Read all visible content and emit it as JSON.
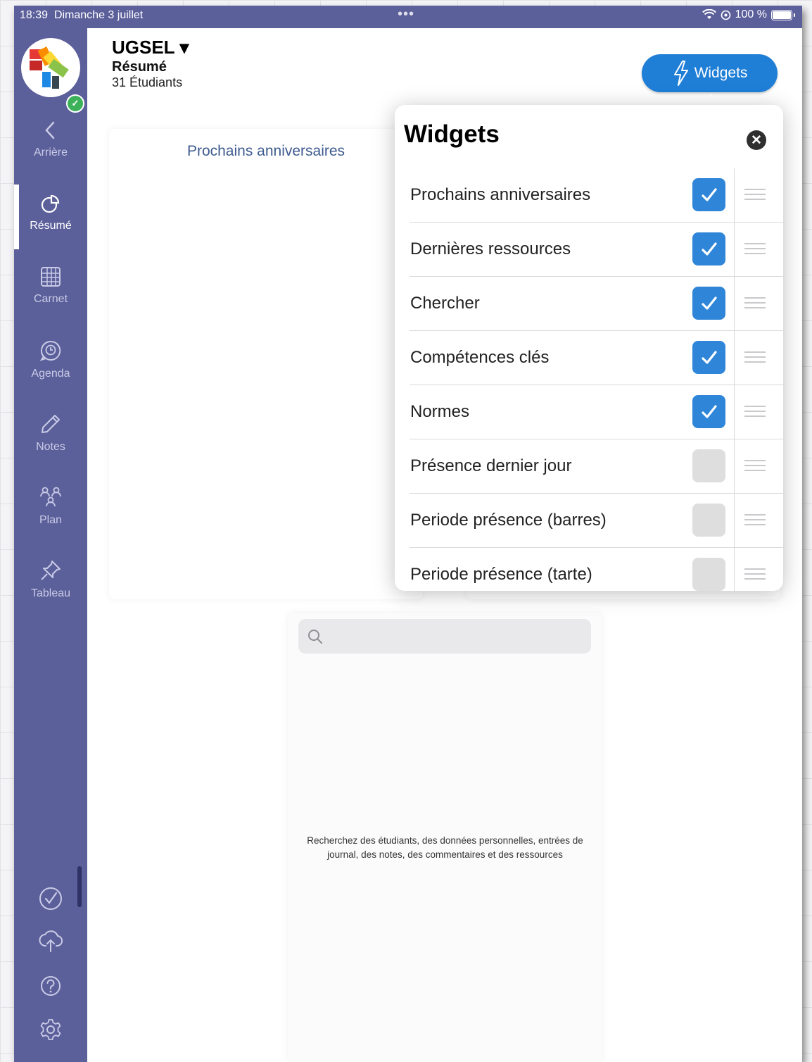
{
  "status_bar": {
    "time": "18:39",
    "date": "Dimanche 3 juillet",
    "battery": "100 %"
  },
  "header": {
    "title": "UGSEL ▾",
    "subtitle": "Résumé",
    "student_count": "31 Étudiants",
    "widgets_button": "Widgets"
  },
  "sidebar": {
    "items": [
      {
        "label": "Arrière",
        "icon": "chevron-left-icon"
      },
      {
        "label": "Résumé",
        "icon": "pie-chart-icon",
        "active": true
      },
      {
        "label": "Carnet",
        "icon": "grid-icon"
      },
      {
        "label": "Agenda",
        "icon": "clock-bubble-icon"
      },
      {
        "label": "Notes",
        "icon": "pencil-icon"
      },
      {
        "label": "Plan",
        "icon": "people-icon"
      },
      {
        "label": "Tableau",
        "icon": "pin-icon"
      }
    ],
    "tools": [
      "check-circle-icon",
      "cloud-upload-icon",
      "help-icon",
      "settings-icon"
    ]
  },
  "cards": {
    "birthdays_title": "Prochains anniversaires",
    "search_help": "Recherchez des étudiants, des données personnelles, entrées de journal, des notes, des commentaires et des ressources"
  },
  "popover": {
    "title": "Widgets",
    "items": [
      {
        "label": "Prochains anniversaires",
        "checked": true
      },
      {
        "label": "Dernières ressources",
        "checked": true
      },
      {
        "label": "Chercher",
        "checked": true
      },
      {
        "label": "Compétences clés",
        "checked": true
      },
      {
        "label": "Normes",
        "checked": true
      },
      {
        "label": "Présence dernier jour",
        "checked": false
      },
      {
        "label": "Periode présence (barres)",
        "checked": false
      },
      {
        "label": "Periode présence (tarte)",
        "checked": false
      }
    ]
  },
  "colors": {
    "sidebar": "#5b5f9a",
    "accent": "#1f7ed6",
    "checkbox_on": "#2f86d8"
  }
}
